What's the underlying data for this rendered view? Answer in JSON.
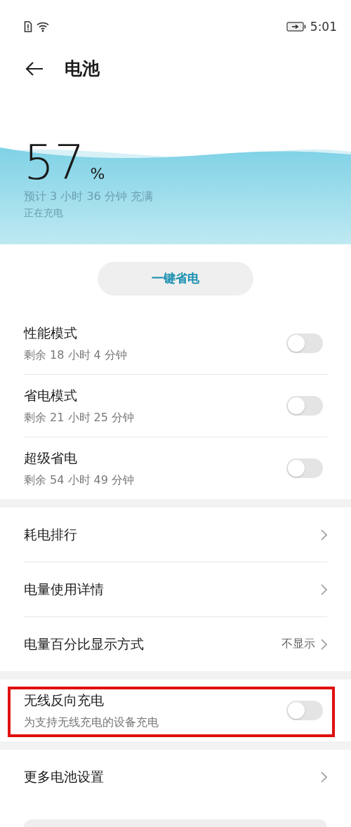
{
  "status_bar": {
    "time": "5:01"
  },
  "header": {
    "title": "电池"
  },
  "battery": {
    "percent": "57",
    "unit": "%",
    "estimate": "预计 3 小时 36 分钟 充满",
    "status": "正在充电"
  },
  "power_save_button": "一键省电",
  "sections": [
    {
      "items": [
        {
          "kind": "toggle",
          "title": "性能模式",
          "subtitle": "剩余 18 小时 4 分钟",
          "on": false
        },
        {
          "kind": "toggle",
          "title": "省电模式",
          "subtitle": "剩余 21 小时 25 分钟",
          "on": false
        },
        {
          "kind": "toggle",
          "title": "超级省电",
          "subtitle": "剩余 54 小时 49 分钟",
          "on": false
        }
      ]
    },
    {
      "items": [
        {
          "kind": "link",
          "title": "耗电排行"
        },
        {
          "kind": "link",
          "title": "电量使用详情"
        },
        {
          "kind": "link",
          "title": "电量百分比显示方式",
          "value": "不显示"
        }
      ]
    },
    {
      "items": [
        {
          "kind": "toggle",
          "title": "无线反向充电",
          "subtitle": "为支持无线充电的设备充电",
          "on": false,
          "highlighted": true
        }
      ]
    },
    {
      "items": [
        {
          "kind": "link",
          "title": "更多电池设置"
        }
      ]
    }
  ]
}
